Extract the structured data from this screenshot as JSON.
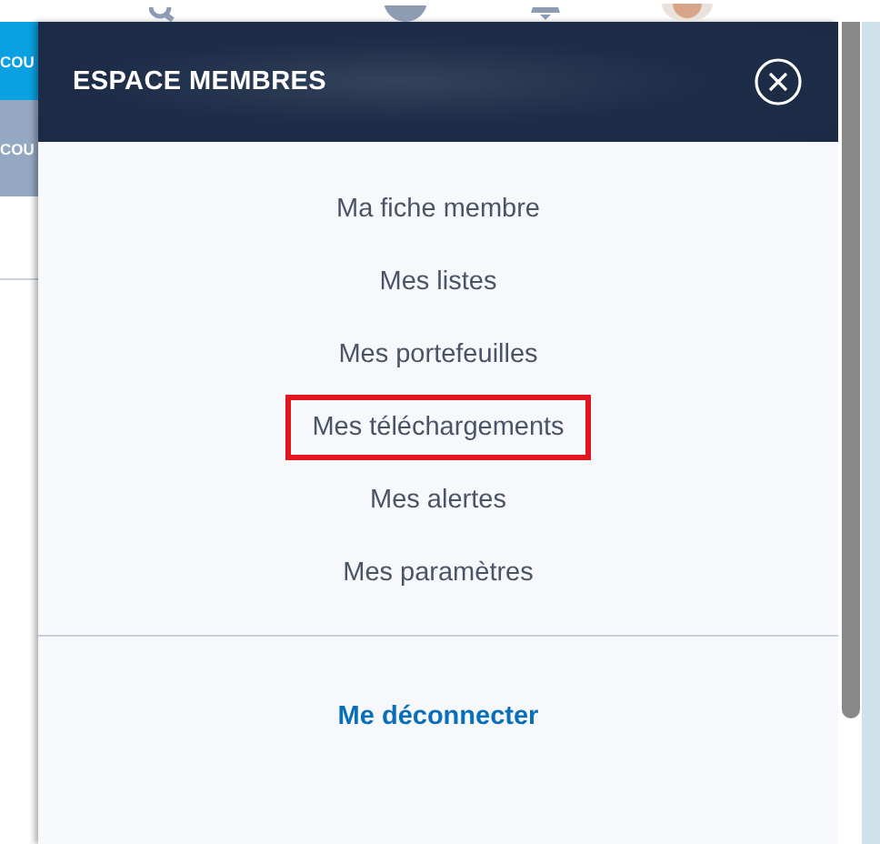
{
  "side_tabs": [
    {
      "label": "COU",
      "selected": true
    },
    {
      "label": "COU",
      "selected": false
    }
  ],
  "panel": {
    "title": "ESPACE MEMBRES",
    "items": [
      {
        "label": "Ma fiche membre",
        "highlighted": false
      },
      {
        "label": "Mes listes",
        "highlighted": false
      },
      {
        "label": "Mes portefeuilles",
        "highlighted": false
      },
      {
        "label": "Mes téléchargements",
        "highlighted": true
      },
      {
        "label": "Mes alertes",
        "highlighted": false
      },
      {
        "label": "Mes paramètres",
        "highlighted": false
      }
    ],
    "logout": "Me déconnecter"
  }
}
